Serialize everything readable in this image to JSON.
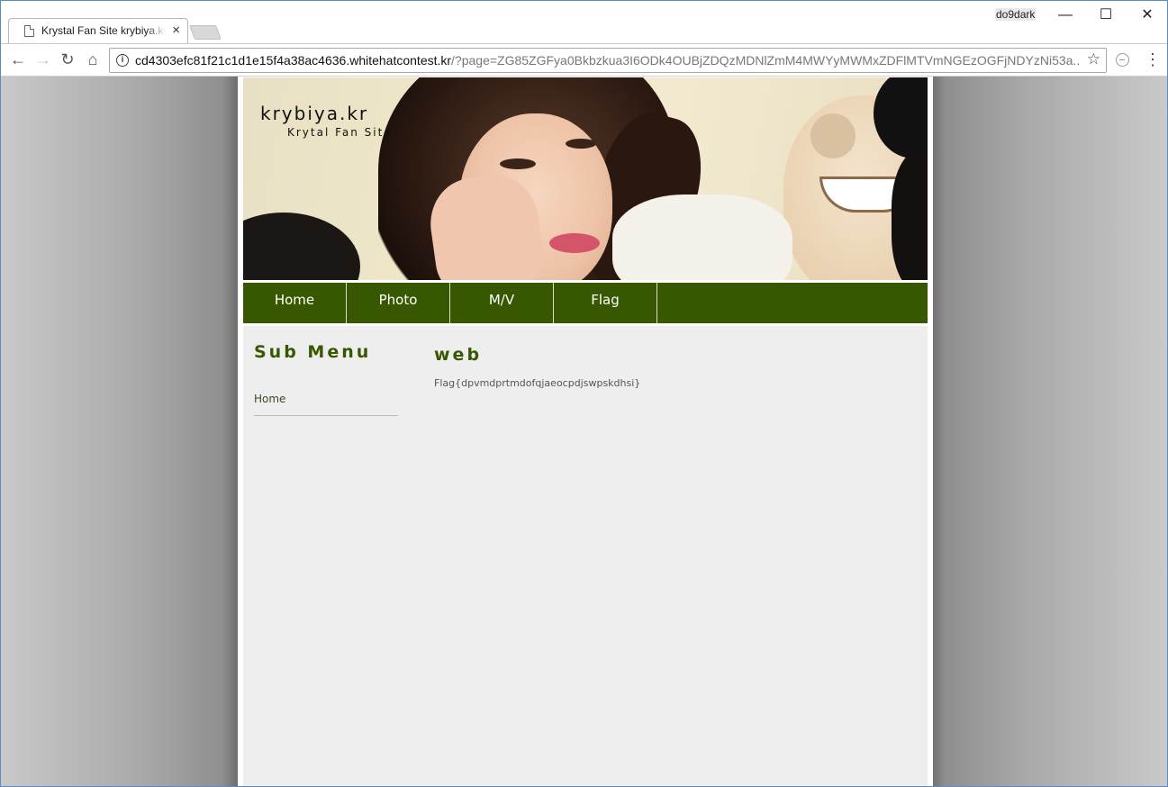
{
  "browser": {
    "tab_title": "Krystal Fan Site krybiya.kr",
    "tab_close": "×",
    "user_name": "do9dark",
    "controls": {
      "minimize": "—",
      "maximize": "☐",
      "close": "✕"
    },
    "nav": {
      "back": "←",
      "forward": "→",
      "reload": "↻",
      "home": "⌂"
    },
    "info_glyph": "i",
    "url_host": "cd4303efc81f21c1d1e15f4a38ac4636.whitehatcontest.kr",
    "url_path": "/?page=ZG85ZGFya0Bkbzkua3I6ODk4OUBjZDQzMDNlZmM4MWYyMWMxZDFlMTVmNGEzOGFjNDYzNi53a...",
    "star": "☆",
    "menu": "⋮"
  },
  "site": {
    "logo": "krybiya.kr",
    "tagline": "Krytal Fan Site",
    "nav": [
      {
        "label": "Home"
      },
      {
        "label": "Photo"
      },
      {
        "label": "M/V"
      },
      {
        "label": "Flag"
      }
    ],
    "sidebar": {
      "title": "Sub Menu",
      "link": "Home"
    },
    "main": {
      "title": "web",
      "text": "Flag{dpvmdprtmdofqjaeocpdjswpskdhsi}"
    },
    "colors": {
      "nav_bg": "#375800",
      "content_bg": "#eeeeee",
      "heading": "#375800"
    }
  }
}
